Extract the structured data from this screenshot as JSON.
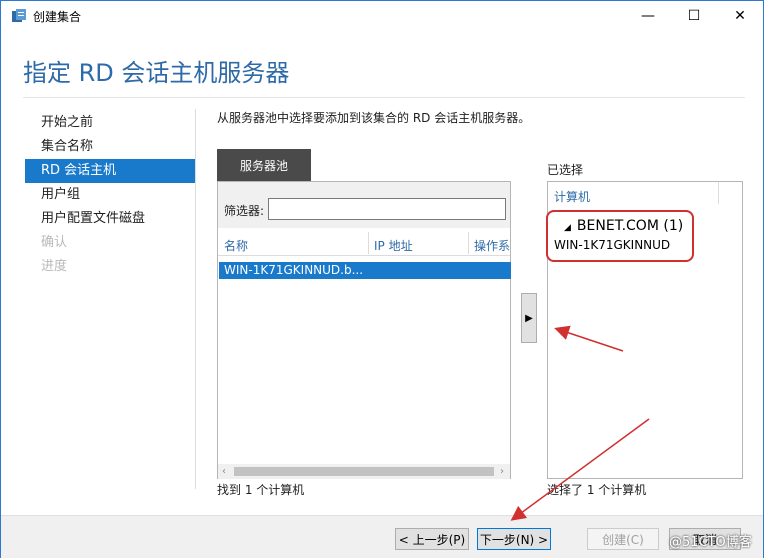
{
  "window": {
    "title": "创建集合",
    "controls": {
      "minimize": "—",
      "maximize": "☐",
      "close": "✕"
    }
  },
  "header": {
    "title": "指定 RD 会话主机服务器"
  },
  "nav": {
    "items": [
      {
        "label": "开始之前",
        "state": "normal"
      },
      {
        "label": "集合名称",
        "state": "normal"
      },
      {
        "label": "RD 会话主机",
        "state": "active"
      },
      {
        "label": "用户组",
        "state": "normal"
      },
      {
        "label": "用户配置文件磁盘",
        "state": "normal"
      },
      {
        "label": "确认",
        "state": "disabled"
      },
      {
        "label": "进度",
        "state": "disabled"
      }
    ]
  },
  "main": {
    "instruction": "从服务器池中选择要添加到该集合的 RD 会话主机服务器。",
    "pool": {
      "tab_label": "服务器池",
      "filter_label": "筛选器:",
      "filter_value": "",
      "columns": [
        "名称",
        "IP 地址",
        "操作系"
      ],
      "rows": [
        "WIN-1K71GKINNUD.b..."
      ],
      "count_text": "找到 1 个计算机"
    },
    "move_button": "▶",
    "selected": {
      "label": "已选择",
      "column": "计算机",
      "group": "BENET.COM (1)",
      "machine": "WIN-1K71GKINNUD",
      "count_text": "选择了 1 个计算机"
    }
  },
  "footer": {
    "prev": "< 上一步(P)",
    "next": "下一步(N) >",
    "create": "创建(C)",
    "cancel": "取消"
  },
  "watermark": "@51CTO博客",
  "colors": {
    "accent": "#1979ca",
    "title": "#2e6aa7",
    "annotation": "#d03030"
  }
}
